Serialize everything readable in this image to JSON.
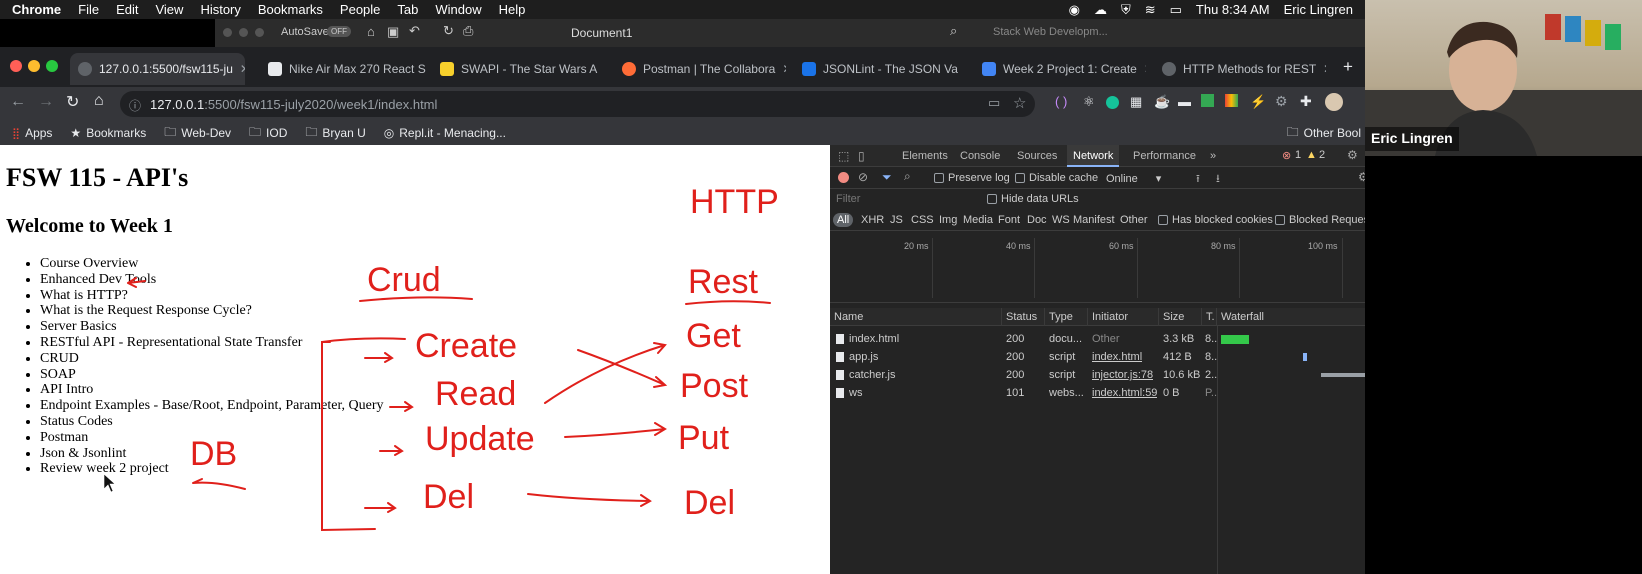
{
  "menubar": {
    "app": "Chrome",
    "items": [
      "File",
      "Edit",
      "View",
      "History",
      "Bookmarks",
      "People",
      "Tab",
      "Window",
      "Help"
    ],
    "clock": "Thu 8:34 AM",
    "user": "Eric Lingren"
  },
  "word": {
    "autosave": "AutoSave",
    "autosave_state": "OFF",
    "document": "Document1",
    "overflow_tab": "Stack Web Developm..."
  },
  "tabs": [
    {
      "title": "127.0.0.1:5500/fsw115-ju",
      "fav_color": "#5f6368"
    },
    {
      "title": "Nike Air Max 270 React S",
      "fav_color": "#e8eaed"
    },
    {
      "title": "SWAPI - The Star Wars A",
      "fav_color": "#f7d02c"
    },
    {
      "title": "Postman | The Collabora",
      "fav_color": "#ff6c37"
    },
    {
      "title": "JSONLint - The JSON Va",
      "fav_color": "#1a73e8"
    },
    {
      "title": "Week 2 Project 1: Create",
      "fav_color": "#4285f4"
    },
    {
      "title": "HTTP Methods for REST",
      "fav_color": "#5f6368"
    }
  ],
  "address": {
    "host": "127.0.0.1",
    "path": ":5500/fsw115-july2020/week1/index.html"
  },
  "bookmarks": [
    "Apps",
    "Bookmarks",
    "Web-Dev",
    "IOD",
    "Bryan U",
    "Repl.it - Menacing...",
    "Other Bool"
  ],
  "page": {
    "title": "FSW 115 - API's",
    "subtitle": "Welcome to Week 1",
    "list": [
      "Course Overview",
      "Enhanced Dev Tools",
      "What is HTTP?",
      "What is the Request Response Cycle?",
      "Server Basics",
      "RESTful API - Representational State Transfer",
      "CRUD",
      "SOAP",
      "API Intro",
      "Endpoint Examples - Base/Root, Endpoint, Parameter, Query",
      "Status Codes",
      "Postman",
      "Json & Jsonlint",
      "Review week 2 project"
    ]
  },
  "annotations": {
    "http": "HTTP",
    "crud": "Crud",
    "rest": "Rest",
    "create": "Create",
    "read": "Read",
    "update": "Update",
    "del": "Del",
    "get": "Get",
    "post": "Post",
    "put": "Put",
    "del_right": "Del",
    "db": "DB",
    "ink_color": "#e0201b"
  },
  "devtools": {
    "tabs": [
      "Elements",
      "Console",
      "Sources",
      "Network",
      "Performance"
    ],
    "active_tab": "Network",
    "errors": "1",
    "warnings": "2",
    "preserve_log": "Preserve log",
    "disable_cache": "Disable cache",
    "throttle": "Online",
    "filter_placeholder": "Filter",
    "hide_data_urls": "Hide data URLs",
    "types": [
      "All",
      "XHR",
      "JS",
      "CSS",
      "Img",
      "Media",
      "Font",
      "Doc",
      "WS",
      "Manifest",
      "Other"
    ],
    "has_blocked": "Has blocked cookies",
    "blocked_requests": "Blocked Requests",
    "timeline": [
      "20 ms",
      "40 ms",
      "60 ms",
      "80 ms",
      "100 ms"
    ],
    "columns": [
      "Name",
      "Status",
      "Type",
      "Initiator",
      "Size",
      "T.",
      "Waterfall"
    ],
    "rows": [
      {
        "name": "index.html",
        "status": "200",
        "type": "docu...",
        "initiator": "Other",
        "size": "3.3 kB",
        "time": "8..."
      },
      {
        "name": "app.js",
        "status": "200",
        "type": "script",
        "initiator": "index.html",
        "size": "412 B",
        "time": "8..."
      },
      {
        "name": "catcher.js",
        "status": "200",
        "type": "script",
        "initiator": "injector.js:78",
        "size": "10.6 kB",
        "time": "2..."
      },
      {
        "name": "ws",
        "status": "101",
        "type": "webs...",
        "initiator": "index.html:59",
        "size": "0 B",
        "time": "P..."
      }
    ]
  },
  "webcam": {
    "name": "Eric Lingren"
  }
}
